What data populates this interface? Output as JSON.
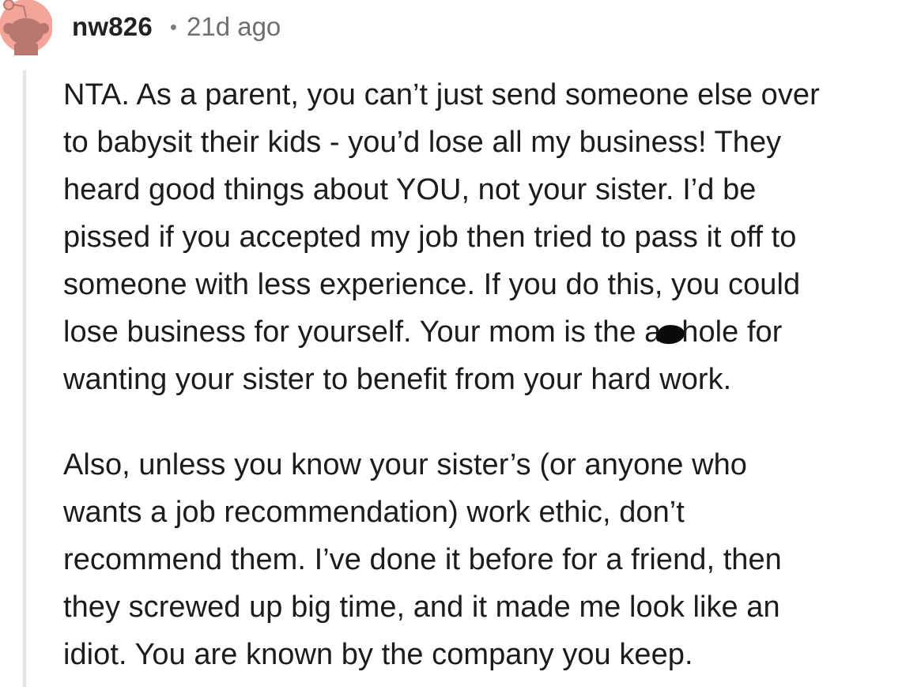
{
  "comment": {
    "author": "nw826",
    "separator": "•",
    "timestamp": "21d ago",
    "avatar_icon": "reddit-snoo-avatar-icon",
    "colors": {
      "avatar_bg": "#f3a59a",
      "avatar_fg": "#b87870",
      "thread_line": "#e4e4e4",
      "text": "#1c1c1c",
      "meta": "#6f6f6f"
    },
    "paragraph1": {
      "line1": "NTA. As a parent, you can’t just send someone else over",
      "line2": "to babysit their kids - you’d lose all my business! They",
      "line3": "heard good things about YOU, not your sister. I’d be",
      "line4": "pissed if you accepted my job then tried to pass it off to",
      "line5": "someone with less experience. If you do this, you could",
      "line6_before": "lose business for yourself. Your mom is the a",
      "line6_after": "hole for",
      "line7": "wanting your sister to benefit from your hard work."
    },
    "paragraph2": {
      "line1": "Also, unless you know your sister’s (or anyone who",
      "line2": "wants a job recommendation) work ethic, don’t",
      "line3": "recommend them. I’ve done it before for a friend, then",
      "line4": "they screwed up big time, and it made me look like an",
      "line5": "idiot. You are known by the company you keep."
    }
  }
}
